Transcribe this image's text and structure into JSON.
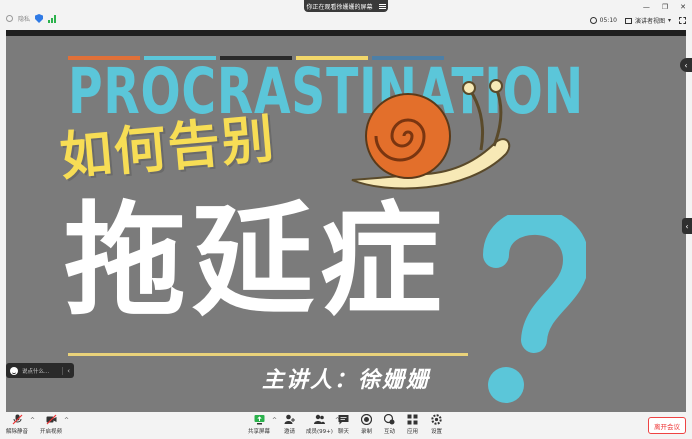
{
  "topbar": {
    "status_label": "隐私",
    "share_notice": "你正在观看徐姗姗的屏幕",
    "time": "05:10",
    "view_mode": "演讲者视图"
  },
  "slide": {
    "english_title": "PROCRASTINATION",
    "title_line1": "如何告别",
    "title_line2": "拖延症",
    "speaker": "主讲人：徐姗姗",
    "stripe_colors": [
      "#e07038",
      "#5bc6d9",
      "#2a2a2a",
      "#f2d76a",
      "#4d7fa6"
    ]
  },
  "chat": {
    "placeholder": "说点什么..."
  },
  "toolbar": {
    "mute": "解除静音",
    "video": "开启视频",
    "share": "共享屏幕",
    "invite": "邀请",
    "members": "成员(99+)",
    "chat": "聊天",
    "record": "录制",
    "interact": "互动",
    "apps": "应用",
    "settings": "设置",
    "leave": "离开会议"
  },
  "colors": {
    "accent_cyan": "#5bc6d9",
    "title_yellow": "#f7dd55",
    "leave_red": "#e33333"
  }
}
